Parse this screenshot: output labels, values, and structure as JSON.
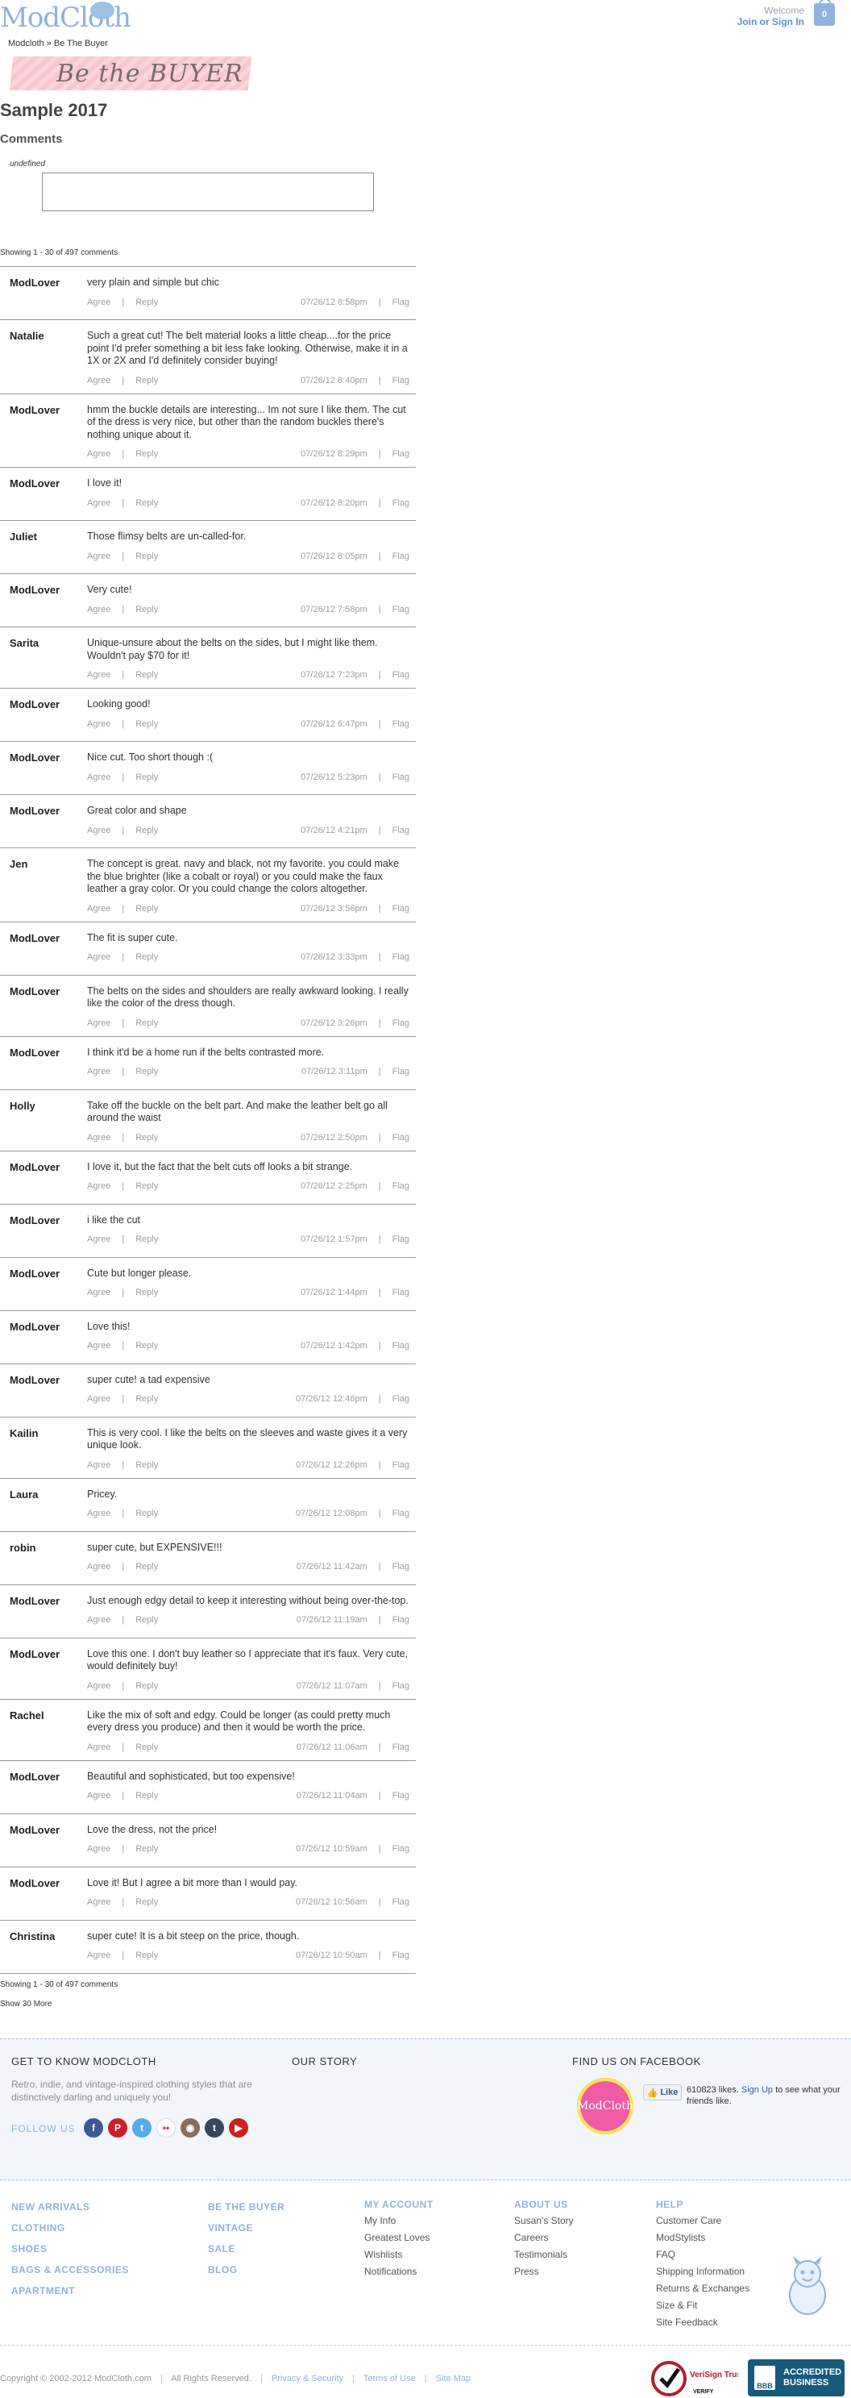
{
  "header": {
    "logo": "ModCloth",
    "welcome": "Welcome",
    "join": "Join or Sign In",
    "bag_count": "0"
  },
  "breadcrumb": "Modcloth » Be The Buyer",
  "banner": "Be the BUYER",
  "page_title": "Sample 2017",
  "comments_title": "Comments",
  "undefined_label": "undefined",
  "showing": "Showing 1 - 30 of 497 comments",
  "show_more": "Show 30 More",
  "labels": {
    "agree": "Agree",
    "reply": "Reply",
    "flag": "Flag",
    "sep": "|"
  },
  "comments": [
    {
      "author": "ModLover",
      "text": "very plain and simple but chic",
      "time": "07/26/12 8:58pm"
    },
    {
      "author": "Natalie",
      "text": "Such a great cut! The belt material looks a little cheap....for the price point I'd prefer something a bit less fake looking. Otherwise, make it in a 1X or 2X and I'd definitely consider buying!",
      "time": "07/26/12 8:40pm"
    },
    {
      "author": "ModLover",
      "text": "hmm the buckle details are interesting... Im not sure I like them. The cut of the dress is very nice, but other than the random buckles there's nothing unique about it.",
      "time": "07/26/12 8:29pm"
    },
    {
      "author": "ModLover",
      "text": "I love it!",
      "time": "07/26/12 8:20pm"
    },
    {
      "author": "Juliet",
      "text": "Those flimsy belts are un-called-for.",
      "time": "07/26/12 8:05pm"
    },
    {
      "author": "ModLover",
      "text": "Very cute!",
      "time": "07/26/12 7:58pm"
    },
    {
      "author": "Sarita",
      "text": "Unique-unsure about the belts on the sides, but I might like them. Wouldn't pay $70 for it!",
      "time": "07/26/12 7:23pm"
    },
    {
      "author": "ModLover",
      "text": "Looking good!",
      "time": "07/26/12 6:47pm"
    },
    {
      "author": "ModLover",
      "text": "Nice cut. Too short though :(",
      "time": "07/26/12 5:23pm"
    },
    {
      "author": "ModLover",
      "text": "Great color and shape",
      "time": "07/26/12 4:21pm"
    },
    {
      "author": "Jen",
      "text": "The concept is great. navy and black, not my favorite. you could make the blue brighter (like a cobalt or royal) or you could make the faux leather a gray color. Or you could change the colors altogether.",
      "time": "07/26/12 3:56pm"
    },
    {
      "author": "ModLover",
      "text": "The fit is super cute.",
      "time": "07/26/12 3:33pm"
    },
    {
      "author": "ModLover",
      "text": "The belts on the sides and shoulders are really awkward looking. I really like the color of the dress though.",
      "time": "07/26/12 3:26pm"
    },
    {
      "author": "ModLover",
      "text": "I think it'd be a home run if the belts contrasted more.",
      "time": "07/26/12 3:11pm"
    },
    {
      "author": "Holly",
      "text": "Take off the buckle on the belt part. And make the leather belt go all around the waist",
      "time": "07/26/12 2:50pm"
    },
    {
      "author": "ModLover",
      "text": "I love it, but the fact that the belt cuts off looks a bit strange.",
      "time": "07/26/12 2:25pm"
    },
    {
      "author": "ModLover",
      "text": "i like the cut",
      "time": "07/26/12 1:57pm"
    },
    {
      "author": "ModLover",
      "text": "Cute but longer please.",
      "time": "07/26/12 1:44pm"
    },
    {
      "author": "ModLover",
      "text": "Love this!",
      "time": "07/26/12 1:42pm"
    },
    {
      "author": "ModLover",
      "text": "super cute! a tad expensive",
      "time": "07/26/12 12:46pm"
    },
    {
      "author": "Kailin",
      "text": "This is very cool. I like the belts on the sleeves and waste gives it a very unique look.",
      "time": "07/26/12 12:26pm"
    },
    {
      "author": "Laura",
      "text": "Pricey.",
      "time": "07/26/12 12:08pm"
    },
    {
      "author": "robin",
      "text": "super cute, but EXPENSIVE!!!",
      "time": "07/26/12 11:42am"
    },
    {
      "author": "ModLover",
      "text": "Just enough edgy detail to keep it interesting without being over-the-top.",
      "time": "07/26/12 11:19am"
    },
    {
      "author": "ModLover",
      "text": "Love this one. I don't buy leather so I appreciate that it's faux. Very cute, would definitely buy!",
      "time": "07/26/12 11:07am"
    },
    {
      "author": "Rachel",
      "text": "Like the mix of soft and edgy. Could be longer (as could pretty much every dress you produce) and then it would be worth the price.",
      "time": "07/26/12 11:06am"
    },
    {
      "author": "ModLover",
      "text": "Beautiful and sophisticated, but too expensive!",
      "time": "07/26/12 11:04am"
    },
    {
      "author": "ModLover",
      "text": "Love the dress, not the price!",
      "time": "07/26/12 10:59am"
    },
    {
      "author": "ModLover",
      "text": "Love it! But I agree a bit more than I would pay.",
      "time": "07/26/12 10:56am"
    },
    {
      "author": "Christina",
      "text": "super cute! It is a bit steep on the price, though.",
      "time": "07/26/12 10:50am"
    }
  ],
  "footer": {
    "know_head": "GET TO KNOW MODCLOTH",
    "know_desc": "Retro, indie, and vintage-inspired clothing styles that are distinctively darling and uniquely you!",
    "follow_us": "FOLLOW US",
    "story_head": "OUR STORY",
    "facebook_head": "FIND US ON FACEBOOK",
    "fb_logo": "ModCloth",
    "like_btn": "Like",
    "like_count": "610823 likes.",
    "sign_up": "Sign Up",
    "like_rest": "to see what your friends like.",
    "social": [
      {
        "name": "facebook-icon",
        "glyph": "f",
        "color": "#3b5998"
      },
      {
        "name": "pinterest-icon",
        "glyph": "P",
        "color": "#cb2027"
      },
      {
        "name": "twitter-icon",
        "glyph": "t",
        "color": "#55acee"
      },
      {
        "name": "flickr-icon",
        "glyph": "••",
        "color": "#ffffff"
      },
      {
        "name": "instagram-icon",
        "glyph": "◉",
        "color": "#8a6e5b"
      },
      {
        "name": "tumblr-icon",
        "glyph": "t",
        "color": "#36465d"
      },
      {
        "name": "youtube-icon",
        "glyph": "▶",
        "color": "#cd201f"
      }
    ],
    "col1": [
      "NEW ARRIVALS",
      "CLOTHING",
      "SHOES",
      "BAGS & ACCESSORIES",
      "APARTMENT"
    ],
    "col2": [
      "BE THE BUYER",
      "VINTAGE",
      "SALE",
      "BLOG"
    ],
    "account_head": "MY ACCOUNT",
    "account": [
      "My Info",
      "Greatest Loves",
      "Wishlists",
      "Notifications"
    ],
    "about_head": "ABOUT US",
    "about": [
      "Susan's Story",
      "Careers",
      "Testimonials",
      "Press"
    ],
    "help_head": "HELP",
    "help": [
      "Customer Care",
      "ModStylists",
      "FAQ",
      "Shipping Information",
      "Returns & Exchanges",
      "Size & Fit",
      "Site Feedback"
    ],
    "copyright": "Copyright © 2002-2012 ModCloth.com",
    "rights": "All Rights Reserved.",
    "privacy": "Privacy & Security",
    "terms": "Terms of Use",
    "sitemap": "Site Map",
    "verisign": "VeriSign Trusted",
    "verify": "VERIFY",
    "bbb_label": "BBB",
    "bbb_text": "ACCREDITED BUSINESS"
  },
  "colors": {
    "accent": "#8fb3dc",
    "link": "#5d8fcf",
    "band": "#f2f6fb"
  }
}
